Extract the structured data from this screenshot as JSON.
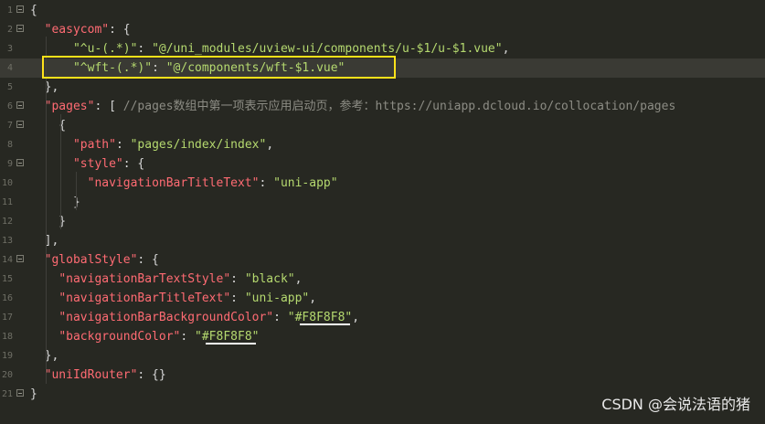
{
  "editor": {
    "lines": [
      {
        "n": "1",
        "fold": true,
        "tokens": [
          {
            "t": "punc",
            "v": "{"
          }
        ]
      },
      {
        "n": "2",
        "fold": true,
        "tokens": [
          {
            "t": "punc",
            "v": "  "
          },
          {
            "t": "key",
            "v": "\"easycom\""
          },
          {
            "t": "punc",
            "v": ": {"
          }
        ]
      },
      {
        "n": "3",
        "fold": false,
        "tokens": [
          {
            "t": "punc",
            "v": "      "
          },
          {
            "t": "str",
            "v": "\"^u-(.*)\""
          },
          {
            "t": "punc",
            "v": ": "
          },
          {
            "t": "str",
            "v": "\"@/uni_modules/uview-ui/components/u-$1/u-$1.vue\""
          },
          {
            "t": "punc",
            "v": ","
          }
        ]
      },
      {
        "n": "4",
        "fold": false,
        "current": true,
        "tokens": [
          {
            "t": "punc",
            "v": "      "
          },
          {
            "t": "str",
            "v": "\"^wft-(.*)\""
          },
          {
            "t": "punc",
            "v": ": "
          },
          {
            "t": "str",
            "v": "\"@/components/wft-$1.vue\""
          }
        ]
      },
      {
        "n": "5",
        "fold": false,
        "tokens": [
          {
            "t": "punc",
            "v": "  },"
          }
        ]
      },
      {
        "n": "6",
        "fold": true,
        "tokens": [
          {
            "t": "punc",
            "v": "  "
          },
          {
            "t": "key",
            "v": "\"pages\""
          },
          {
            "t": "punc",
            "v": ": [ "
          },
          {
            "t": "cmt",
            "v": "//pages数组中第一项表示应用启动页，参考：https://uniapp.dcloud.io/collocation/pages"
          }
        ]
      },
      {
        "n": "7",
        "fold": true,
        "tokens": [
          {
            "t": "punc",
            "v": "    {"
          }
        ]
      },
      {
        "n": "8",
        "fold": false,
        "tokens": [
          {
            "t": "punc",
            "v": "      "
          },
          {
            "t": "key",
            "v": "\"path\""
          },
          {
            "t": "punc",
            "v": ": "
          },
          {
            "t": "str",
            "v": "\"pages/index/index\""
          },
          {
            "t": "punc",
            "v": ","
          }
        ]
      },
      {
        "n": "9",
        "fold": true,
        "tokens": [
          {
            "t": "punc",
            "v": "      "
          },
          {
            "t": "key",
            "v": "\"style\""
          },
          {
            "t": "punc",
            "v": ": {"
          }
        ]
      },
      {
        "n": "10",
        "fold": false,
        "tokens": [
          {
            "t": "punc",
            "v": "        "
          },
          {
            "t": "key",
            "v": "\"navigationBarTitleText\""
          },
          {
            "t": "punc",
            "v": ": "
          },
          {
            "t": "str",
            "v": "\"uni-app\""
          }
        ]
      },
      {
        "n": "11",
        "fold": false,
        "tokens": [
          {
            "t": "punc",
            "v": "      }"
          }
        ]
      },
      {
        "n": "12",
        "fold": false,
        "tokens": [
          {
            "t": "punc",
            "v": "    }"
          }
        ]
      },
      {
        "n": "13",
        "fold": false,
        "tokens": [
          {
            "t": "punc",
            "v": "  ],"
          }
        ]
      },
      {
        "n": "14",
        "fold": true,
        "tokens": [
          {
            "t": "punc",
            "v": "  "
          },
          {
            "t": "key",
            "v": "\"globalStyle\""
          },
          {
            "t": "punc",
            "v": ": {"
          }
        ]
      },
      {
        "n": "15",
        "fold": false,
        "tokens": [
          {
            "t": "punc",
            "v": "    "
          },
          {
            "t": "key",
            "v": "\"navigationBarTextStyle\""
          },
          {
            "t": "punc",
            "v": ": "
          },
          {
            "t": "str",
            "v": "\"black\""
          },
          {
            "t": "punc",
            "v": ","
          }
        ]
      },
      {
        "n": "16",
        "fold": false,
        "tokens": [
          {
            "t": "punc",
            "v": "    "
          },
          {
            "t": "key",
            "v": "\"navigationBarTitleText\""
          },
          {
            "t": "punc",
            "v": ": "
          },
          {
            "t": "str",
            "v": "\"uni-app\""
          },
          {
            "t": "punc",
            "v": ","
          }
        ]
      },
      {
        "n": "17",
        "fold": false,
        "tokens": [
          {
            "t": "punc",
            "v": "    "
          },
          {
            "t": "key",
            "v": "\"navigationBarBackgroundColor\""
          },
          {
            "t": "punc",
            "v": ": "
          },
          {
            "t": "str",
            "v": "\"#F8F8F8\""
          },
          {
            "t": "punc",
            "v": ","
          }
        ]
      },
      {
        "n": "18",
        "fold": false,
        "tokens": [
          {
            "t": "punc",
            "v": "    "
          },
          {
            "t": "key",
            "v": "\"backgroundColor\""
          },
          {
            "t": "punc",
            "v": ": "
          },
          {
            "t": "str",
            "v": "\"#F8F8F8\""
          }
        ]
      },
      {
        "n": "19",
        "fold": false,
        "tokens": [
          {
            "t": "punc",
            "v": "  },"
          }
        ]
      },
      {
        "n": "20",
        "fold": false,
        "tokens": [
          {
            "t": "punc",
            "v": "  "
          },
          {
            "t": "key",
            "v": "\"uniIdRouter\""
          },
          {
            "t": "punc",
            "v": ": {}"
          }
        ]
      },
      {
        "n": "21",
        "fold": true,
        "tokens": [
          {
            "t": "punc",
            "v": "}"
          }
        ]
      }
    ]
  },
  "watermark": "CSDN @会说法语的猪",
  "colors": {
    "background": "#272822",
    "key": "#ff6b73",
    "string": "#b5d96f",
    "comment": "#8c8c84",
    "highlight_box": "#ffe21a"
  }
}
